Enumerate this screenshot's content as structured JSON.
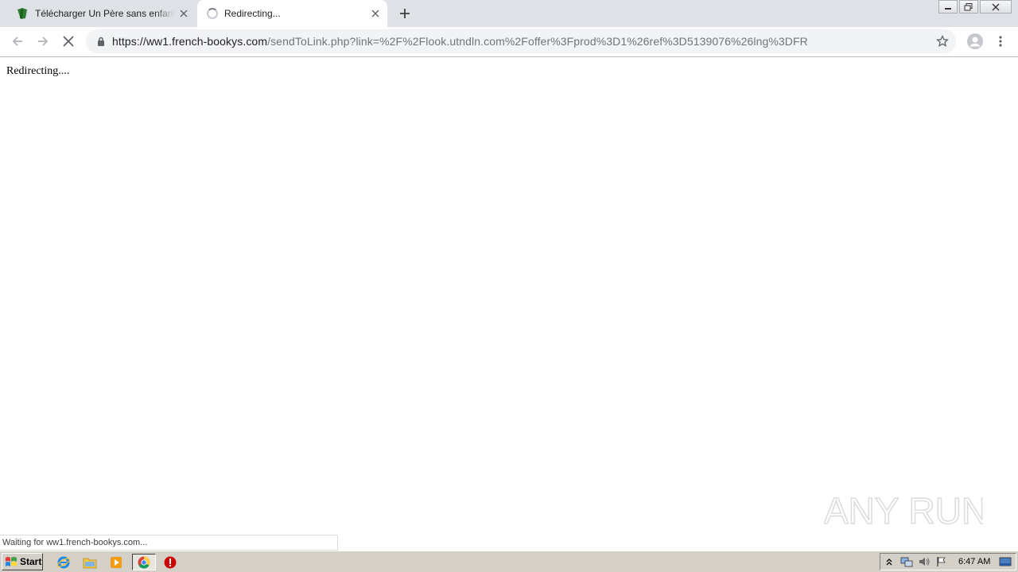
{
  "browser": {
    "tabs": [
      {
        "title": "Télécharger Un Père sans enfant - D",
        "favicon": "book-icon",
        "state": "inactive"
      },
      {
        "title": "Redirecting...",
        "favicon": "loading-spinner",
        "state": "active"
      }
    ],
    "address": {
      "host": "https://ww1.french-bookys.com",
      "path": "/sendToLink.php?link=%2F%2Flook.utndln.com%2Foffer%3Fprod%3D1%26ref%3D5139076%26lng%3DFR"
    }
  },
  "page": {
    "body_text": "Redirecting....",
    "status_text": "Waiting for ww1.french-bookys.com..."
  },
  "watermark": {
    "text": "ANY RUN"
  },
  "taskbar": {
    "start_label": "Start",
    "clock": "6:47 AM"
  },
  "colors": {
    "tabstrip": "#dee1e6",
    "omnibox": "#f1f3f4",
    "taskbar": "#d4d0c8",
    "book_favicon": "#2e7d32",
    "stop_icon": "#cc0000"
  }
}
